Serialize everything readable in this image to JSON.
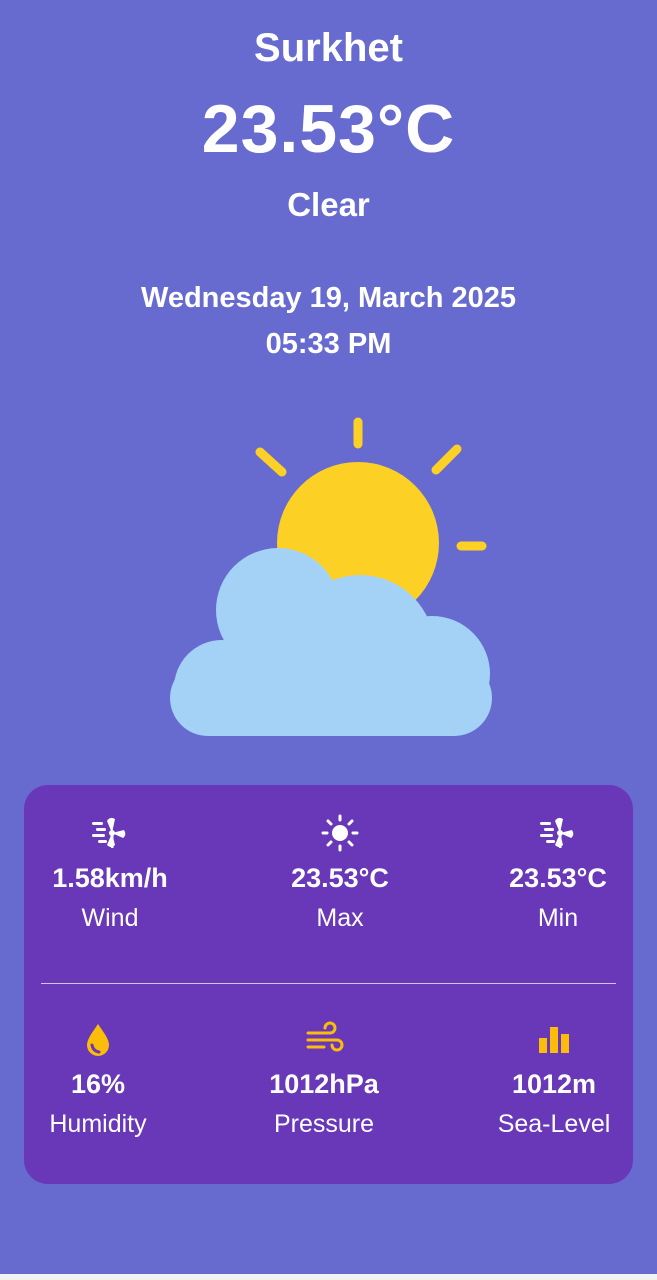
{
  "location": {
    "city": "Surkhet"
  },
  "current": {
    "temperature": "23.53°C",
    "condition": "Clear",
    "date": "Wednesday 19, March 2025",
    "time": "05:33 PM"
  },
  "illustration": {
    "icon": "sun-behind-cloud-icon"
  },
  "stats": {
    "wind": {
      "value": "1.58km/h",
      "label": "Wind",
      "icon": "wind-icon"
    },
    "max": {
      "value": "23.53°C",
      "label": "Max",
      "icon": "sun-icon"
    },
    "min": {
      "value": "23.53°C",
      "label": "Min",
      "icon": "wind-icon"
    },
    "humidity": {
      "value": "16%",
      "label": "Humidity",
      "icon": "water-drop-icon"
    },
    "pressure": {
      "value": "1012hPa",
      "label": "Pressure",
      "icon": "air-flow-icon"
    },
    "sea_level": {
      "value": "1012m",
      "label": "Sea-Level",
      "icon": "bar-chart-icon"
    }
  },
  "colors": {
    "background": "#676bcf",
    "card": "#6838b8",
    "sun": "#fdd026",
    "cloud": "#a3d2f6",
    "icon_accent": "#fbbc0a"
  }
}
